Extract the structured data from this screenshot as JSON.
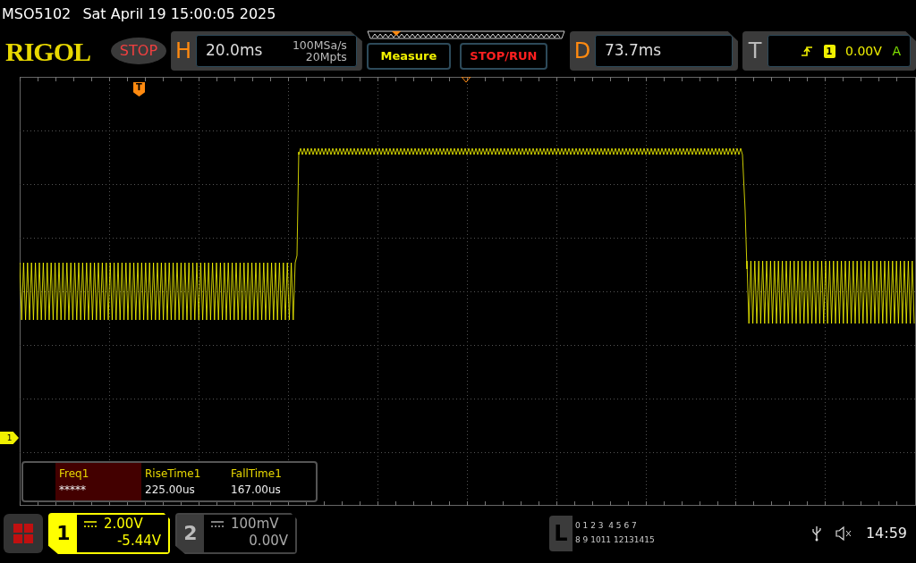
{
  "top_bar": {
    "model": "MSO5102",
    "datetime": "Sat April 19 15:00:05 2025"
  },
  "logo": "RIGOL",
  "run_state": {
    "label": "STOP",
    "kind": "stop"
  },
  "horizontal": {
    "letter": "H",
    "timebase": "20.0ms",
    "sample_rate": "100MSa/s",
    "memory_depth": "20Mpts"
  },
  "buttons": [
    {
      "label": "Measure",
      "kind": "measure"
    },
    {
      "label": "STOP/RUN",
      "kind": "stoprun"
    }
  ],
  "delay": {
    "letter": "D",
    "value": "73.7ms"
  },
  "trigger": {
    "letter": "T",
    "source": "1",
    "level": "0.00V",
    "mode": "A"
  },
  "trigger_marker": "T",
  "channel_marker": "1",
  "measurements": [
    {
      "name": "Freq1",
      "value": "*****",
      "selected": true
    },
    {
      "name": "RiseTime1",
      "value": "225.00us",
      "selected": false
    },
    {
      "name": "FallTime1",
      "value": "167.00us",
      "selected": false
    }
  ],
  "channels": [
    {
      "number": "1",
      "scale": "2.00V",
      "offset": "-5.44V",
      "on": true
    },
    {
      "number": "2",
      "scale": "100mV",
      "offset": "0.00V",
      "on": false
    }
  ],
  "logic": {
    "letter": "L",
    "row_1": "0 1 2 3  4 5 6 7",
    "row_2": "8 9 1011 12131415"
  },
  "clock": "14:59"
}
